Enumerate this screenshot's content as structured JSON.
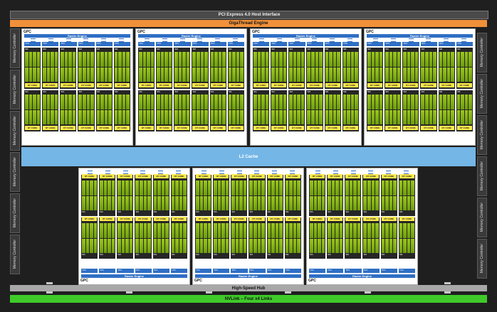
{
  "top": {
    "pcie": "PCI Express 4.0 Host Interface",
    "giga": "GigaThread Engine"
  },
  "l2": "L2 Cache",
  "hub": "High-Speed Hub",
  "nvlink": "NVLink – Four x4 Links",
  "memory_controller": "Memory Controller",
  "gpc_label": "GPC",
  "raster": "Raster Engine",
  "tpc": "TPC",
  "polymorph": "PolyMorph Engine",
  "sm": "SM",
  "rt_core": "RT CORE",
  "colors": {
    "raster": "#2f6fc5",
    "cores": "#8cbc19",
    "rt": "#ffe94a",
    "l2": "#74b6e6",
    "nvlink": "#3fca2a",
    "giga": "#f0913a"
  }
}
